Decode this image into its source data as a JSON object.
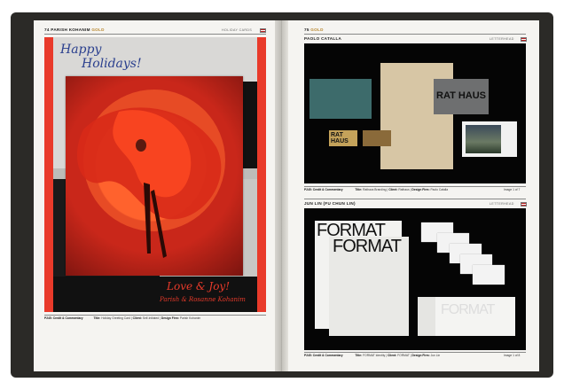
{
  "left_page": {
    "number": "74",
    "name": "PARISH KOHANIM",
    "award": "GOLD",
    "category": "HOLIDAY CARDS",
    "artwork": {
      "greeting_line1": "Happy",
      "greeting_line2": "Holidays!",
      "closing_line": "Love & Joy!",
      "signature": "Parish & Rosanne Kohanim"
    },
    "caption": {
      "code": "P245: Credit & Commentary",
      "title_label": "Title:",
      "title": "Holiday Greeting Card",
      "client_label": "Client:",
      "client": "Self-Initiated",
      "firm_label": "Design Firm:",
      "firm": "Parish Kohanim"
    }
  },
  "right_page": {
    "number": "75",
    "award": "GOLD",
    "entries": [
      {
        "name": "PAOLO CATALLA",
        "category": "LETTERHEAD",
        "artwork_text": "RAT HAUS",
        "caption": {
          "code": "P245: Credit & Commentary",
          "title_label": "Title:",
          "title": "Rathaus Branding",
          "client_label": "Client:",
          "client": "Rathaus",
          "firm_label": "Design Firm:",
          "firm": "Paolo Catalla",
          "pages": "Image 1 of 7"
        }
      },
      {
        "name": "JUN LIN (FU CHUN LIN)",
        "category": "LETTERHEAD",
        "artwork_text": "FORMAT",
        "caption": {
          "code": "P245: Credit & Commentary",
          "title_label": "Title:",
          "title": "FORMAT Identity",
          "client_label": "Client:",
          "client": "FORMAT",
          "firm_label": "Design Firm:",
          "firm": "Jun Lin",
          "pages": "Image 1 of 8"
        }
      }
    ]
  },
  "colors": {
    "book_cover": "#2b2a27",
    "paper": "#f5f4f1",
    "card_red": "#e93a2a",
    "script_blue": "#2a3f8e",
    "gold": "#b8862c"
  }
}
